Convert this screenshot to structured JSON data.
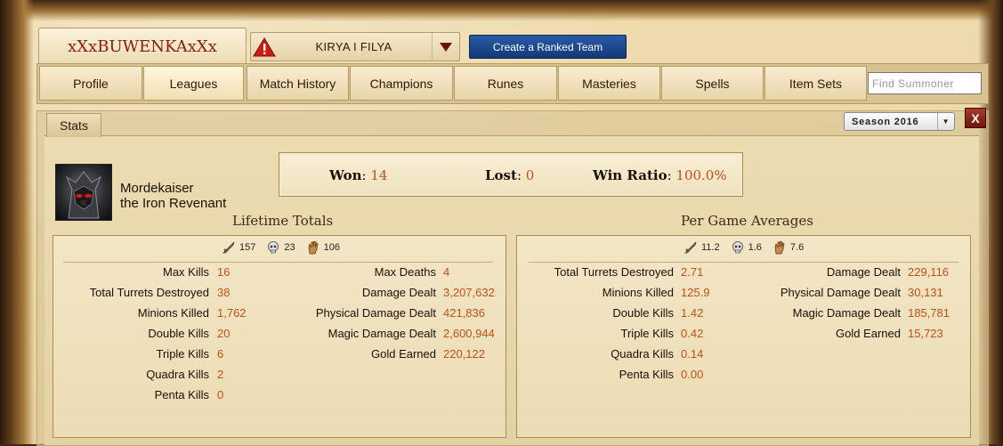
{
  "summoner": {
    "name": "xXxBUWENKAxXx"
  },
  "notice": {
    "text": "KIRYA I FILYA"
  },
  "create_ranked_button": "Create a Ranked Team",
  "tabs": [
    "Profile",
    "Leagues",
    "Match History",
    "Champions",
    "Runes",
    "Masteries",
    "Spells",
    "Item Sets"
  ],
  "active_tab": "Leagues",
  "search": {
    "placeholder": "Find Summoner"
  },
  "stats_tab": "Stats",
  "season": {
    "selected": "Season 2016"
  },
  "close_label": "X",
  "champion": {
    "name": "Mordekaiser",
    "title": "the Iron Revenant"
  },
  "record": {
    "won_label": "Won",
    "won": "14",
    "lost_label": "Lost",
    "lost": "0",
    "ratio_label": "Win Ratio",
    "ratio": "100.0%"
  },
  "lifetime": {
    "title": "Lifetime Totals",
    "kills": "157",
    "deaths": "23",
    "assists": "106",
    "left": [
      {
        "label": "Max Kills",
        "value": "16"
      },
      {
        "label": "Total Turrets Destroyed",
        "value": "38"
      },
      {
        "label": "Minions Killed",
        "value": "1,762"
      },
      {
        "label": "Double Kills",
        "value": "20"
      },
      {
        "label": "Triple Kills",
        "value": "6"
      },
      {
        "label": "Quadra Kills",
        "value": "2"
      },
      {
        "label": "Penta Kills",
        "value": "0"
      }
    ],
    "right": [
      {
        "label": "Max Deaths",
        "value": "4"
      },
      {
        "label": "Damage Dealt",
        "value": "3,207,632"
      },
      {
        "label": "Physical Damage Dealt",
        "value": "421,836"
      },
      {
        "label": "Magic Damage Dealt",
        "value": "2,600,944"
      },
      {
        "label": "Gold Earned",
        "value": "220,122"
      }
    ]
  },
  "averages": {
    "title": "Per Game Averages",
    "kills": "11.2",
    "deaths": "1.6",
    "assists": "7.6",
    "left": [
      {
        "label": "Total Turrets Destroyed",
        "value": "2.71"
      },
      {
        "label": "Minions Killed",
        "value": "125.9"
      },
      {
        "label": "Double Kills",
        "value": "1.42"
      },
      {
        "label": "Triple Kills",
        "value": "0.42"
      },
      {
        "label": "Quadra Kills",
        "value": "0.14"
      },
      {
        "label": "Penta Kills",
        "value": "0.00"
      }
    ],
    "right": [
      {
        "label": "Damage Dealt",
        "value": "229,116"
      },
      {
        "label": "Physical Damage Dealt",
        "value": "30,131"
      },
      {
        "label": "Magic Damage Dealt",
        "value": "185,781"
      },
      {
        "label": "Gold Earned",
        "value": "15,723"
      }
    ]
  },
  "colors": {
    "value": "#c0501a",
    "summoner": "#8a1c10",
    "button": "#1a4a90"
  },
  "icons": [
    "warning-icon",
    "dropdown-arrow-icon",
    "sword-icon",
    "skull-icon",
    "hand-icon",
    "close-icon"
  ]
}
